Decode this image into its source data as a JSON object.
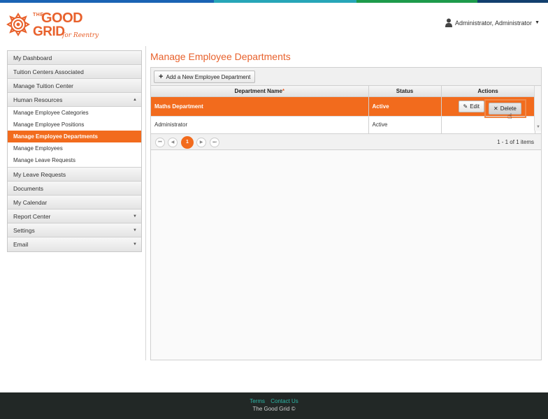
{
  "colors": {
    "accent": "#f26b1d",
    "brand": "#e8612c",
    "footer_bg": "#222826",
    "footer_link": "#2db7a6",
    "top_strip": [
      "#1a63b4",
      "#27a6b8",
      "#1d9b4b",
      "#123f6e"
    ]
  },
  "header": {
    "logo": {
      "the": "THE",
      "good": "GOOD",
      "grid": "GRID",
      "tagline": "for Reentry"
    },
    "user_label": "Administrator, Administrator",
    "user_icon": "user-avatar-icon",
    "caret_icon": "caret-down-icon"
  },
  "sidebar": {
    "items": [
      {
        "label": "My Dashboard"
      },
      {
        "label": "Tuition Centers Associated"
      },
      {
        "label": "Manage Tuition Center"
      },
      {
        "label": "Human Resources",
        "arrow": "▲",
        "children": [
          {
            "label": "Manage Employee Categories"
          },
          {
            "label": "Manage Employee Positions"
          },
          {
            "label": "Manage Employee Departments",
            "active": true
          },
          {
            "label": "Manage Employees"
          },
          {
            "label": "Manage Leave Requests"
          }
        ]
      },
      {
        "label": "My Leave Requests"
      },
      {
        "label": "Documents"
      },
      {
        "label": "My Calendar"
      },
      {
        "label": "Report Center",
        "arrow": "▼"
      },
      {
        "label": "Settings",
        "arrow": "▼"
      },
      {
        "label": "Email",
        "arrow": "▼"
      }
    ]
  },
  "main": {
    "title": "Manage Employee Departments",
    "add_button": "Add a New Employee Department",
    "columns": {
      "name": "Department Name",
      "required_mark": "*",
      "status": "Status",
      "actions": "Actions"
    },
    "rows": [
      {
        "name": "Maths Department",
        "status": "Active",
        "selected": true
      },
      {
        "name": "Administrator",
        "status": "Active",
        "selected": false
      }
    ],
    "edit_label": "Edit",
    "delete_label": "Delete",
    "edit_icon": "✎",
    "delete_icon": "✕",
    "pager": {
      "first": "⏮",
      "prev": "◀",
      "current": "1",
      "next": "▶",
      "last": "⏭",
      "info": "1 - 1 of 1 items"
    }
  },
  "footer": {
    "terms": "Terms",
    "contact": "Contact Us",
    "copyright": "The Good Grid ©"
  }
}
